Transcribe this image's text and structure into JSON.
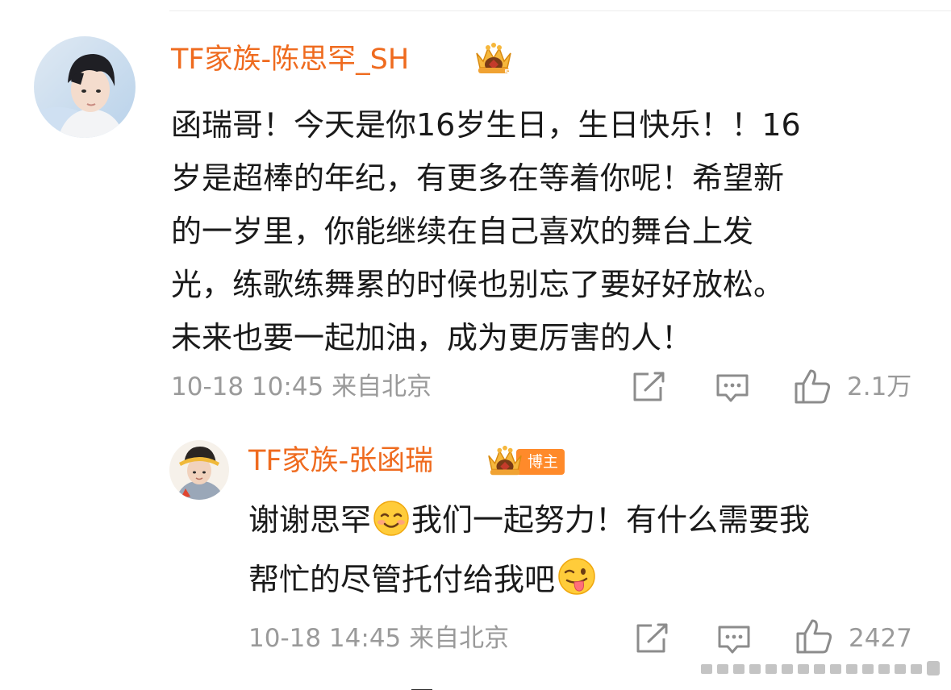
{
  "comment": {
    "username": "TF家族-陈思罕_SH",
    "lines": [
      "函瑞哥！今天是你16岁生日，生日快乐！！16",
      "岁是超棒的年纪，有更多在等着你呢！希望新",
      "的一岁里，你能继续在自己喜欢的舞台上发",
      "光，练歌练舞累的时候也别忘了要好好放松。",
      "未来也要一起加油，成为更厉害的人！"
    ],
    "time": "10-18 10:45 来自北京",
    "likes": "2.1万"
  },
  "reply": {
    "username": "TF家族-张函瑞",
    "badge": "博主",
    "line1_a": "谢谢思罕",
    "line1_b": "我们一起努力！有什么需要我",
    "line2": "帮忙的尽管托付给我吧",
    "emoji1": "smiling-face-icon",
    "emoji2": "winking-tongue-face-icon",
    "time": "10-18 14:45 来自北京",
    "likes": "2427"
  },
  "colors": {
    "username": "#ef6b1f",
    "meta": "#9a9a9a",
    "badge": "#ff8a2a"
  },
  "icons": [
    "crown-badge-icon",
    "share-icon",
    "comment-icon",
    "like-icon"
  ]
}
